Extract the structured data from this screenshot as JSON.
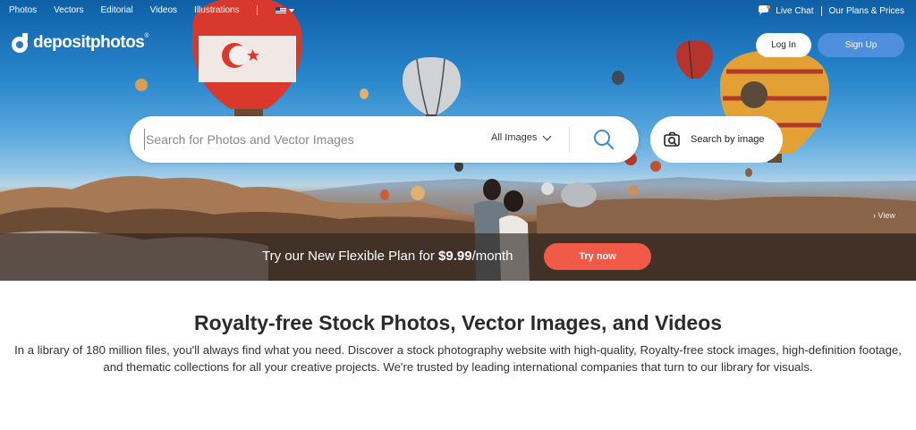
{
  "topnav": {
    "links": [
      "Photos",
      "Vectors",
      "Editorial",
      "Videos",
      "Illustrations"
    ],
    "live_chat": "Live Chat",
    "plans": "Our Plans & Prices"
  },
  "brand": {
    "name": "depositphotos",
    "mark": "®"
  },
  "auth": {
    "login": "Log In",
    "signup": "Sign Up"
  },
  "search": {
    "placeholder": "Search for Photos and Vector Images",
    "category": "All Images",
    "by_image": "Search by image"
  },
  "hero": {
    "view_link": "View"
  },
  "promo": {
    "text_before": "Try our New Flexible Plan for ",
    "price": "$9.99",
    "text_after": "/month",
    "cta": "Try now"
  },
  "main": {
    "heading": "Royalty-free Stock Photos, Vector Images, and Videos",
    "description": "In a library of 180 million files, you'll always find what you need. Discover a stock photography website with high-quality, Royalty-free stock images, high-definition footage, and thematic collections for all your creative projects. We're trusted by leading international companies that turn to our library for visuals."
  },
  "colors": {
    "accent_blue": "#4d8fdc",
    "cta_red": "#f15a46"
  }
}
